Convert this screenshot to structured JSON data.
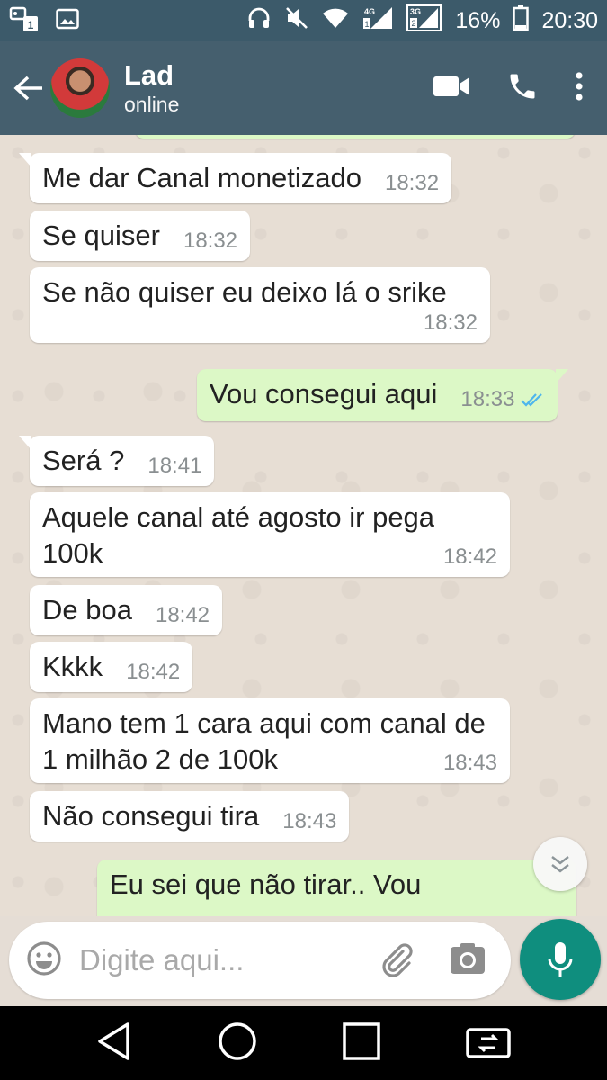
{
  "status_bar": {
    "battery_percent": "16%",
    "time": "20:30",
    "net_4g": "4G",
    "net_3g": "3G"
  },
  "header": {
    "contact_name": "Lad",
    "status": "online"
  },
  "messages": [
    {
      "dir": "in",
      "text": "Me dar Canal monetizado",
      "time": "18:32"
    },
    {
      "dir": "in",
      "text": "Se quiser",
      "time": "18:32"
    },
    {
      "dir": "in",
      "text": "Se não quiser eu deixo lá o srike",
      "time": "18:32"
    },
    {
      "dir": "out",
      "text": "Vou consegui aqui",
      "time": "18:33"
    },
    {
      "dir": "in",
      "text": "Será ?",
      "time": "18:41"
    },
    {
      "dir": "in",
      "text": "Aquele canal até agosto ir pega 100k",
      "time": "18:42"
    },
    {
      "dir": "in",
      "text": "De boa",
      "time": "18:42"
    },
    {
      "dir": "in",
      "text": "Kkkk",
      "time": "18:42"
    },
    {
      "dir": "in",
      "text": "Mano tem 1 cara aqui com canal de 1 milhão 2 de 100k",
      "time": "18:43"
    },
    {
      "dir": "in",
      "text": "Não consegui tira",
      "time": "18:43"
    },
    {
      "dir": "out",
      "text": "Eu sei que não tirar.. Vou",
      "time": ""
    }
  ],
  "composer": {
    "placeholder": "Digite aqui..."
  },
  "colors": {
    "header": "#455f6e",
    "statusbar": "#3c5a6a",
    "outgoing_bubble": "#dcf8c6",
    "incoming_bubble": "#ffffff",
    "mic_button": "#0f8e7e",
    "read_ticks": "#4fb6ec"
  }
}
